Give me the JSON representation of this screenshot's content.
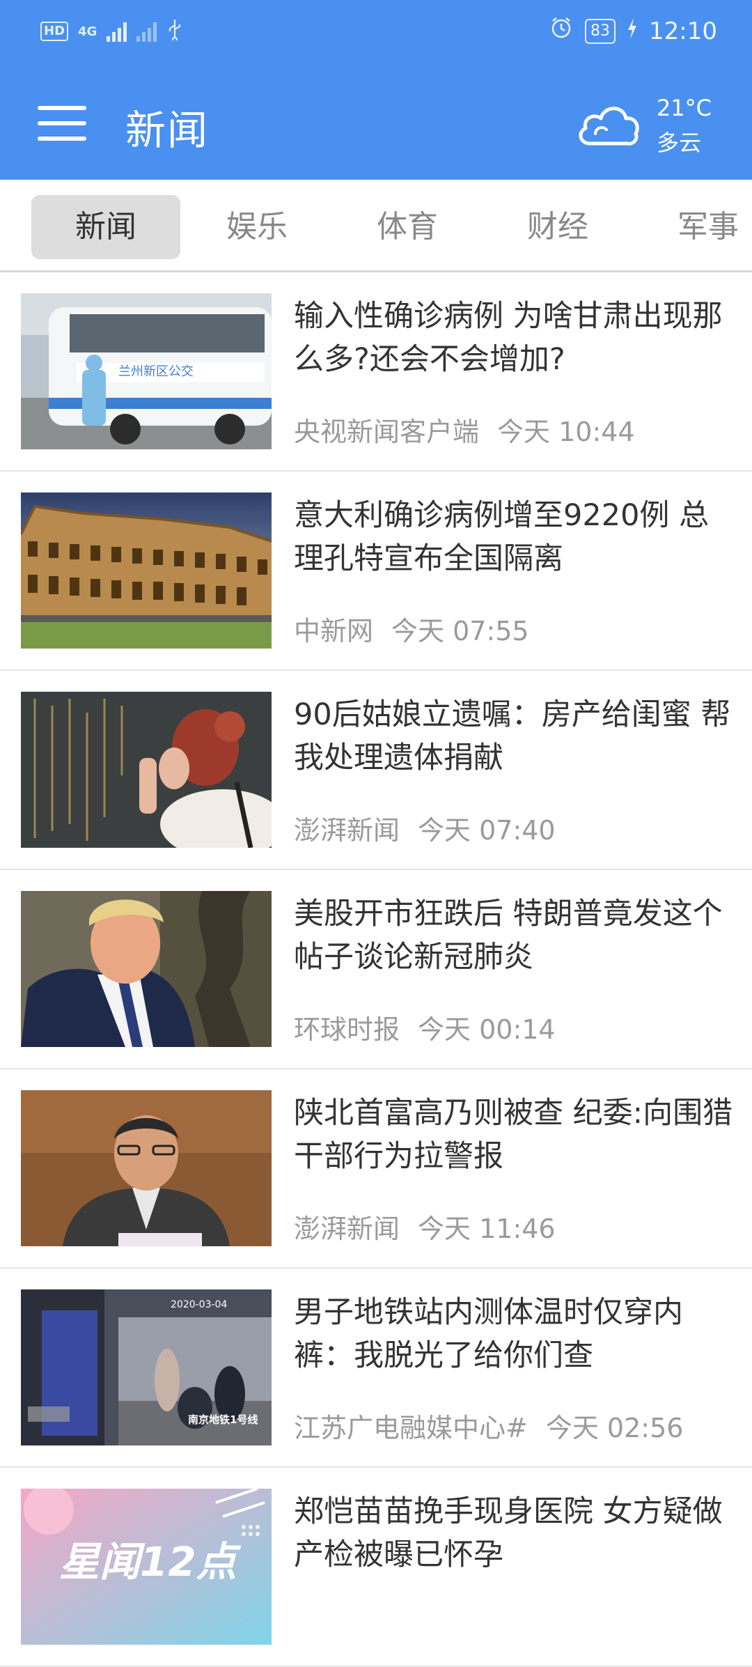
{
  "status_bar": {
    "hd": "HD",
    "network": "4G",
    "battery": "83",
    "time": "12:10"
  },
  "header": {
    "title": "新闻",
    "weather": {
      "temperature": "21°C",
      "condition": "多云"
    }
  },
  "tabs": [
    {
      "label": "新闻"
    },
    {
      "label": "娱乐"
    },
    {
      "label": "体育"
    },
    {
      "label": "财经"
    },
    {
      "label": "军事"
    }
  ],
  "news": [
    {
      "title": "输入性确诊病例 为啥甘肃出现那么多?还会不会增加?",
      "source": "央视新闻客户端",
      "time": "今天 10:44",
      "thumb_caption": "兰州新区公交"
    },
    {
      "title": "意大利确诊病例增至9220例 总理孔特宣布全国隔离",
      "source": "中新网",
      "time": "今天 07:55"
    },
    {
      "title": "90后姑娘立遗嘱：房产给闺蜜 帮我处理遗体捐献",
      "source": "澎湃新闻",
      "time": "今天 07:40"
    },
    {
      "title": "美股开市狂跌后 特朗普竟发这个帖子谈论新冠肺炎",
      "source": "环球时报",
      "time": "今天 00:14"
    },
    {
      "title": "陕北首富高乃则被查 纪委:向围猎干部行为拉警报",
      "source": "澎湃新闻",
      "time": "今天 11:46"
    },
    {
      "title": "男子地铁站内测体温时仅穿内裤：我脱光了给你们查",
      "source": "江苏广电融媒中心#",
      "time": "今天 02:56",
      "thumb_caption": "南京地铁1号线",
      "thumb_timestamp": "2020-03-04"
    },
    {
      "title": "郑恺苗苗挽手现身医院 女方疑做产检被曝已怀孕",
      "source": "",
      "time": "",
      "thumb_caption": "星闻12点"
    }
  ],
  "colors": {
    "topbar": "#4A90F0",
    "tab_active_bg": "#dddddd",
    "meta_text": "#9a9a9a"
  },
  "icons": {
    "menu": "hamburger-icon",
    "weather": "cloud-icon",
    "alarm": "alarm-icon",
    "usb": "usb-icon"
  }
}
